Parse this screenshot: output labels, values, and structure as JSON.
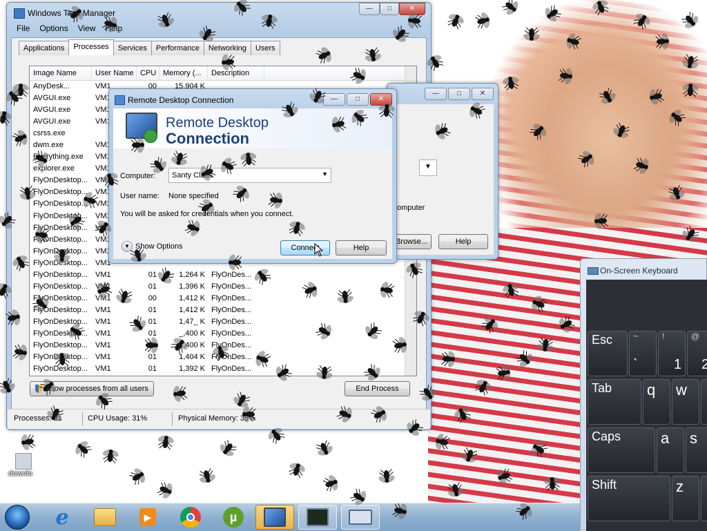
{
  "task_manager": {
    "title": "Windows Task Manager",
    "menu": [
      "File",
      "Options",
      "View",
      "Help"
    ],
    "tabs": [
      "Applications",
      "Processes",
      "Services",
      "Performance",
      "Networking",
      "Users"
    ],
    "active_tab": "Processes",
    "columns": [
      "Image Name",
      "User Name",
      "CPU",
      "Memory (...",
      "Description"
    ],
    "rows": [
      [
        "AnyDesk...",
        "VM1",
        "00",
        "15,904 K",
        ""
      ],
      [
        "AVGUI.exe",
        "VM1",
        "",
        "",
        ""
      ],
      [
        "AVGUI.exe",
        "VM1",
        "",
        "",
        ""
      ],
      [
        "AVGUI.exe",
        "VM1",
        "",
        "",
        ""
      ],
      [
        "csrss.exe",
        "",
        "",
        "",
        ""
      ],
      [
        "dwm.exe",
        "VM1",
        "",
        "",
        ""
      ],
      [
        "Everything.exe",
        "VM1",
        "",
        "",
        ""
      ],
      [
        "explorer.exe",
        "VM1",
        "",
        "",
        ""
      ],
      [
        "FlyOnDesktop...",
        "VM1",
        "",
        "",
        ""
      ],
      [
        "FlyOnDesktop...",
        "VM1",
        "",
        "",
        ""
      ],
      [
        "FlyOnDesktop...",
        "VM1",
        "",
        "",
        ""
      ],
      [
        "FlyOnDesktop...",
        "VM1",
        "",
        "",
        ""
      ],
      [
        "FlyOnDesktop...",
        "VM1",
        "",
        "",
        ""
      ],
      [
        "FlyOnDesktop...",
        "VM1",
        "",
        "",
        ""
      ],
      [
        "FlyOnDesktop...",
        "VM1",
        "",
        "",
        ""
      ],
      [
        "FlyOnDesktop...",
        "VM1",
        "",
        "",
        ""
      ],
      [
        "FlyOnDesktop...",
        "VM1",
        "01",
        "1,264 K",
        "FlyOnDes..."
      ],
      [
        "FlyOnDesktop...",
        "VM1",
        "01",
        "1,396 K",
        "FlyOnDes..."
      ],
      [
        "FlyOnDesktop...",
        "VM1",
        "00",
        "1,412 K",
        "FlyOnDes..."
      ],
      [
        "FlyOnDesktop...",
        "VM1",
        "01",
        "1,412 K",
        "FlyOnDes..."
      ],
      [
        "FlyOnDesktop...",
        "VM1",
        "01",
        "1,47_ K",
        "FlyOnDes..."
      ],
      [
        "FlyOnDesktop...",
        "VM1",
        "01",
        "_,400 K",
        "FlyOnDes..."
      ],
      [
        "FlyOnDesktop...",
        "VM1",
        "01",
        "1,400 K",
        "FlyOnDes..."
      ],
      [
        "FlyOnDesktop...",
        "VM1",
        "01",
        "1,404 K",
        "FlyOnDes..."
      ],
      [
        "FlyOnDesktop...",
        "VM1",
        "01",
        "1,392 K",
        "FlyOnDes..."
      ]
    ],
    "show_all_label": "Show processes from all users",
    "end_process_label": "End Process",
    "status": {
      "processes": "Processes: 91",
      "cpu": "CPU Usage: 31%",
      "memory": "Physical Memory: 35%"
    }
  },
  "rdc": {
    "title": "Remote Desktop Connection",
    "banner_line1": "Remote Desktop",
    "banner_line2": "Connection",
    "computer_label": "Computer:",
    "computer_value": "Santy Claus",
    "user_label": "User name:",
    "user_value": "None specified",
    "credentials_note": "You will be asked for credentials when you connect.",
    "show_options_label": "Show Options",
    "connect_label": "Connect",
    "help_label": "Help"
  },
  "rdc_back": {
    "partial_text": "omputer",
    "browse_label": "Browse...",
    "help_label": "Help"
  },
  "osk": {
    "title": "On-Screen Keyboard",
    "keys": {
      "esc": "Esc",
      "tilde_top": "~",
      "tilde_bottom": "`",
      "excl_top": "!",
      "one": "1",
      "at_top": "@",
      "two": "2",
      "tab": "Tab",
      "q": "q",
      "w": "w",
      "caps": "Caps",
      "a": "a",
      "s": "s",
      "shift": "Shift",
      "z": "z"
    }
  },
  "desktop": {
    "icon_label": "downlo"
  },
  "taskbar": {
    "items": [
      "start-orb",
      "internet-explorer",
      "file-explorer",
      "media-player",
      "chrome",
      "utorrent",
      "remote-desktop",
      "task-manager",
      "on-screen-keyboard"
    ],
    "active": "remote-desktop"
  },
  "colors": {
    "title_bar": "#bcd2ea",
    "rdc_banner_text": "#1a3f7a",
    "osk_bg": "#2c3036",
    "taskbar": "#8fb0cf",
    "stripe_red": "#d43a48"
  }
}
